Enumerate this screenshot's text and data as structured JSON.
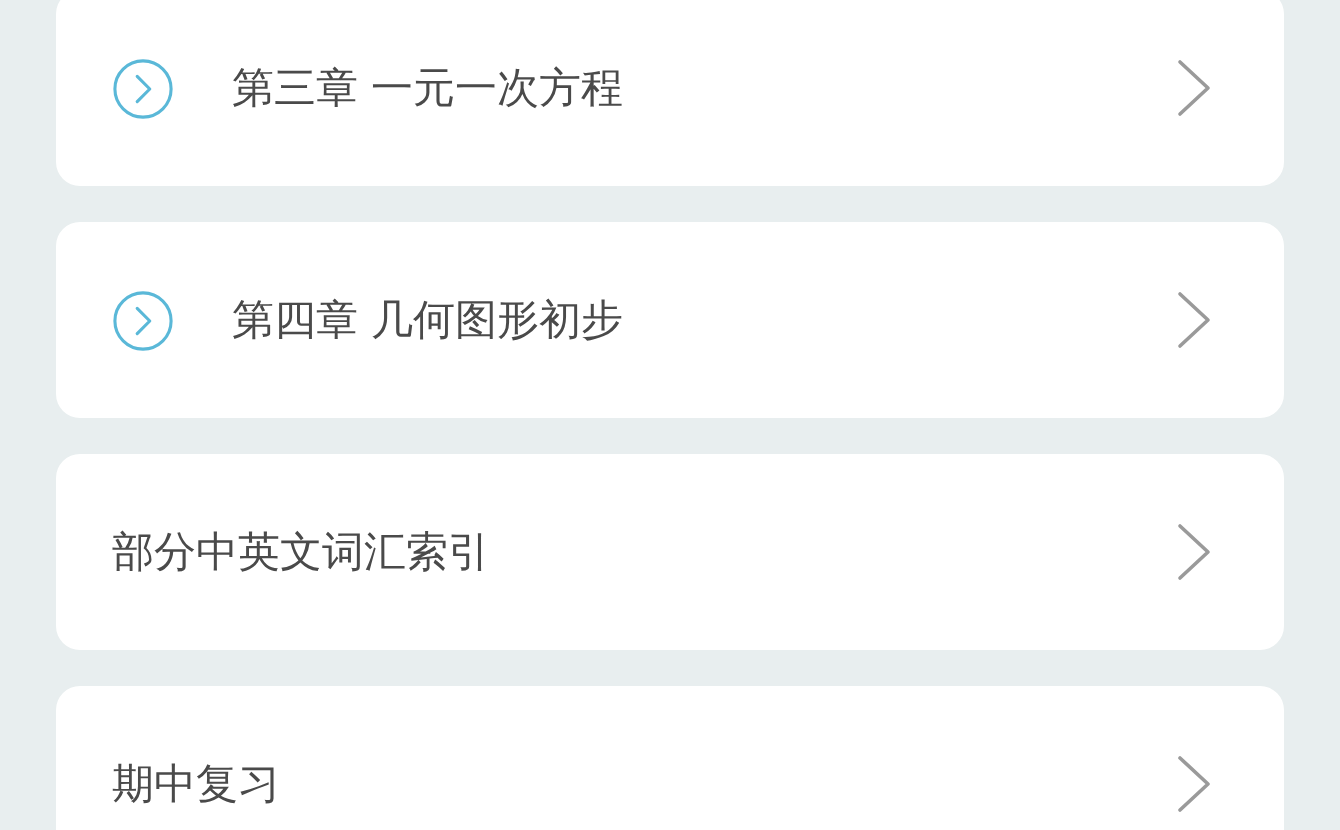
{
  "items": [
    {
      "kind": "chapter",
      "title": "第三章 一元一次方程"
    },
    {
      "kind": "chapter",
      "title": "第四章 几何图形初步"
    },
    {
      "kind": "plain",
      "title": "部分中英文词汇索引"
    },
    {
      "kind": "plain",
      "title": "期中复习"
    }
  ]
}
